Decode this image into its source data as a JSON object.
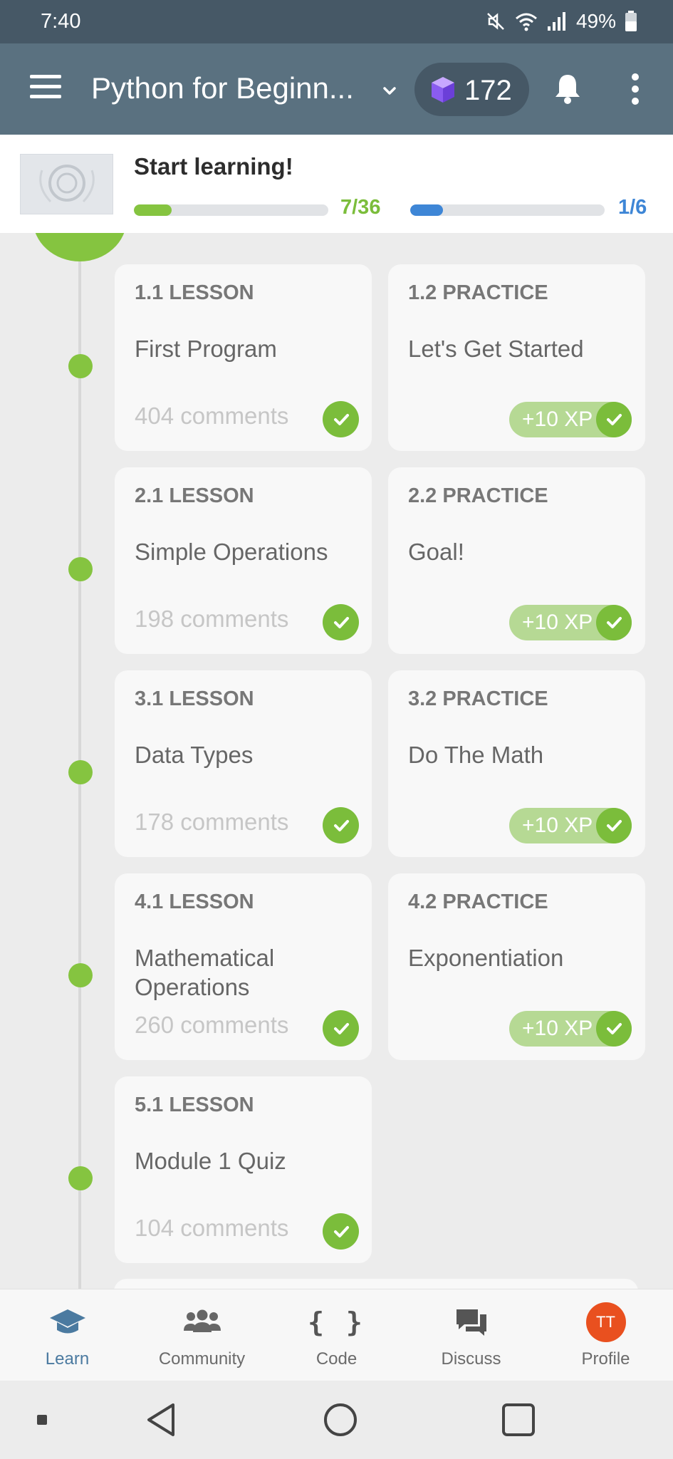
{
  "status_bar": {
    "time": "7:40",
    "battery": "49%"
  },
  "app_bar": {
    "course_title": "Python for Beginn...",
    "gems": "172"
  },
  "progress": {
    "title": "Start learning!",
    "lessons_count": "7/36",
    "lessons_fraction": 0.194,
    "modules_count": "1/6",
    "modules_fraction": 0.167,
    "lessons_color": "#85c440",
    "modules_color": "#3e86d6"
  },
  "cards": [
    {
      "type": "1.1 LESSON",
      "title": "First Program",
      "comments": "404 comments"
    },
    {
      "type": "1.2 PRACTICE",
      "title": "Let's Get Started",
      "xp": "+10 XP"
    },
    {
      "type": "2.1 LESSON",
      "title": "Simple Operations",
      "comments": "198 comments"
    },
    {
      "type": "2.2 PRACTICE",
      "title": "Goal!",
      "xp": "+10 XP"
    },
    {
      "type": "3.1 LESSON",
      "title": "Data Types",
      "comments": "178 comments"
    },
    {
      "type": "3.2 PRACTICE",
      "title": "Do The Math",
      "xp": "+10 XP"
    },
    {
      "type": "4.1 LESSON",
      "title": "Mathematical Operations",
      "comments": "260 comments"
    },
    {
      "type": "4.2 PRACTICE",
      "title": "Exponentiation",
      "xp": "+10 XP"
    },
    {
      "type": "5.1 LESSON",
      "title": "Module 1 Quiz",
      "comments": "104 comments"
    }
  ],
  "bottom_nav": {
    "items": [
      {
        "label": "Learn",
        "icon": "graduation-cap-icon"
      },
      {
        "label": "Community",
        "icon": "people-icon"
      },
      {
        "label": "Code",
        "icon": "braces-icon",
        "glyph": "{ }"
      },
      {
        "label": "Discuss",
        "icon": "chat-bubbles-icon"
      },
      {
        "label": "Profile",
        "icon": "avatar",
        "initials": "TT"
      }
    ]
  },
  "colors": {
    "accent_green": "#85c440",
    "app_bar": "#5a7180",
    "status_bar": "#465866",
    "active_nav": "#4b7aa0",
    "avatar": "#e9501f"
  }
}
